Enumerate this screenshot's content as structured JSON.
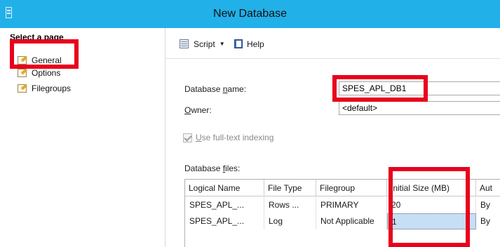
{
  "window": {
    "title": "New Database"
  },
  "left_pane": {
    "header": "Select a page",
    "pages": [
      {
        "label": "General",
        "icon": "properties-page-icon"
      },
      {
        "label": "Options",
        "icon": "properties-page-icon"
      },
      {
        "label": "Filegroups",
        "icon": "properties-page-icon"
      }
    ]
  },
  "toolbar": {
    "script_label": "Script",
    "help_label": "Help"
  },
  "form": {
    "database_name_label_pre": "Database ",
    "database_name_label_u": "n",
    "database_name_label_post": "ame:",
    "database_name_value": "SPES_APL_DB1",
    "owner_label_u": "O",
    "owner_label_post": "wner:",
    "owner_value": "<default>",
    "fulltext_label_u": "U",
    "fulltext_label_post": "se full-text indexing",
    "fulltext_checked": true,
    "files_label_pre": "Database ",
    "files_label_u": "f",
    "files_label_post": "iles:"
  },
  "files_grid": {
    "columns": [
      "Logical Name",
      "File Type",
      "Filegroup",
      "Initial Size (MB)",
      "Aut"
    ],
    "rows": [
      [
        "SPES_APL_...",
        "Rows ...",
        "PRIMARY",
        "20",
        "By"
      ],
      [
        "SPES_APL_...",
        "Log",
        "Not Applicable",
        "1",
        "By"
      ]
    ]
  },
  "colors": {
    "titlebar": "#22b0e8",
    "highlight": "#e8001c",
    "selected_cell": "#c6def6"
  }
}
